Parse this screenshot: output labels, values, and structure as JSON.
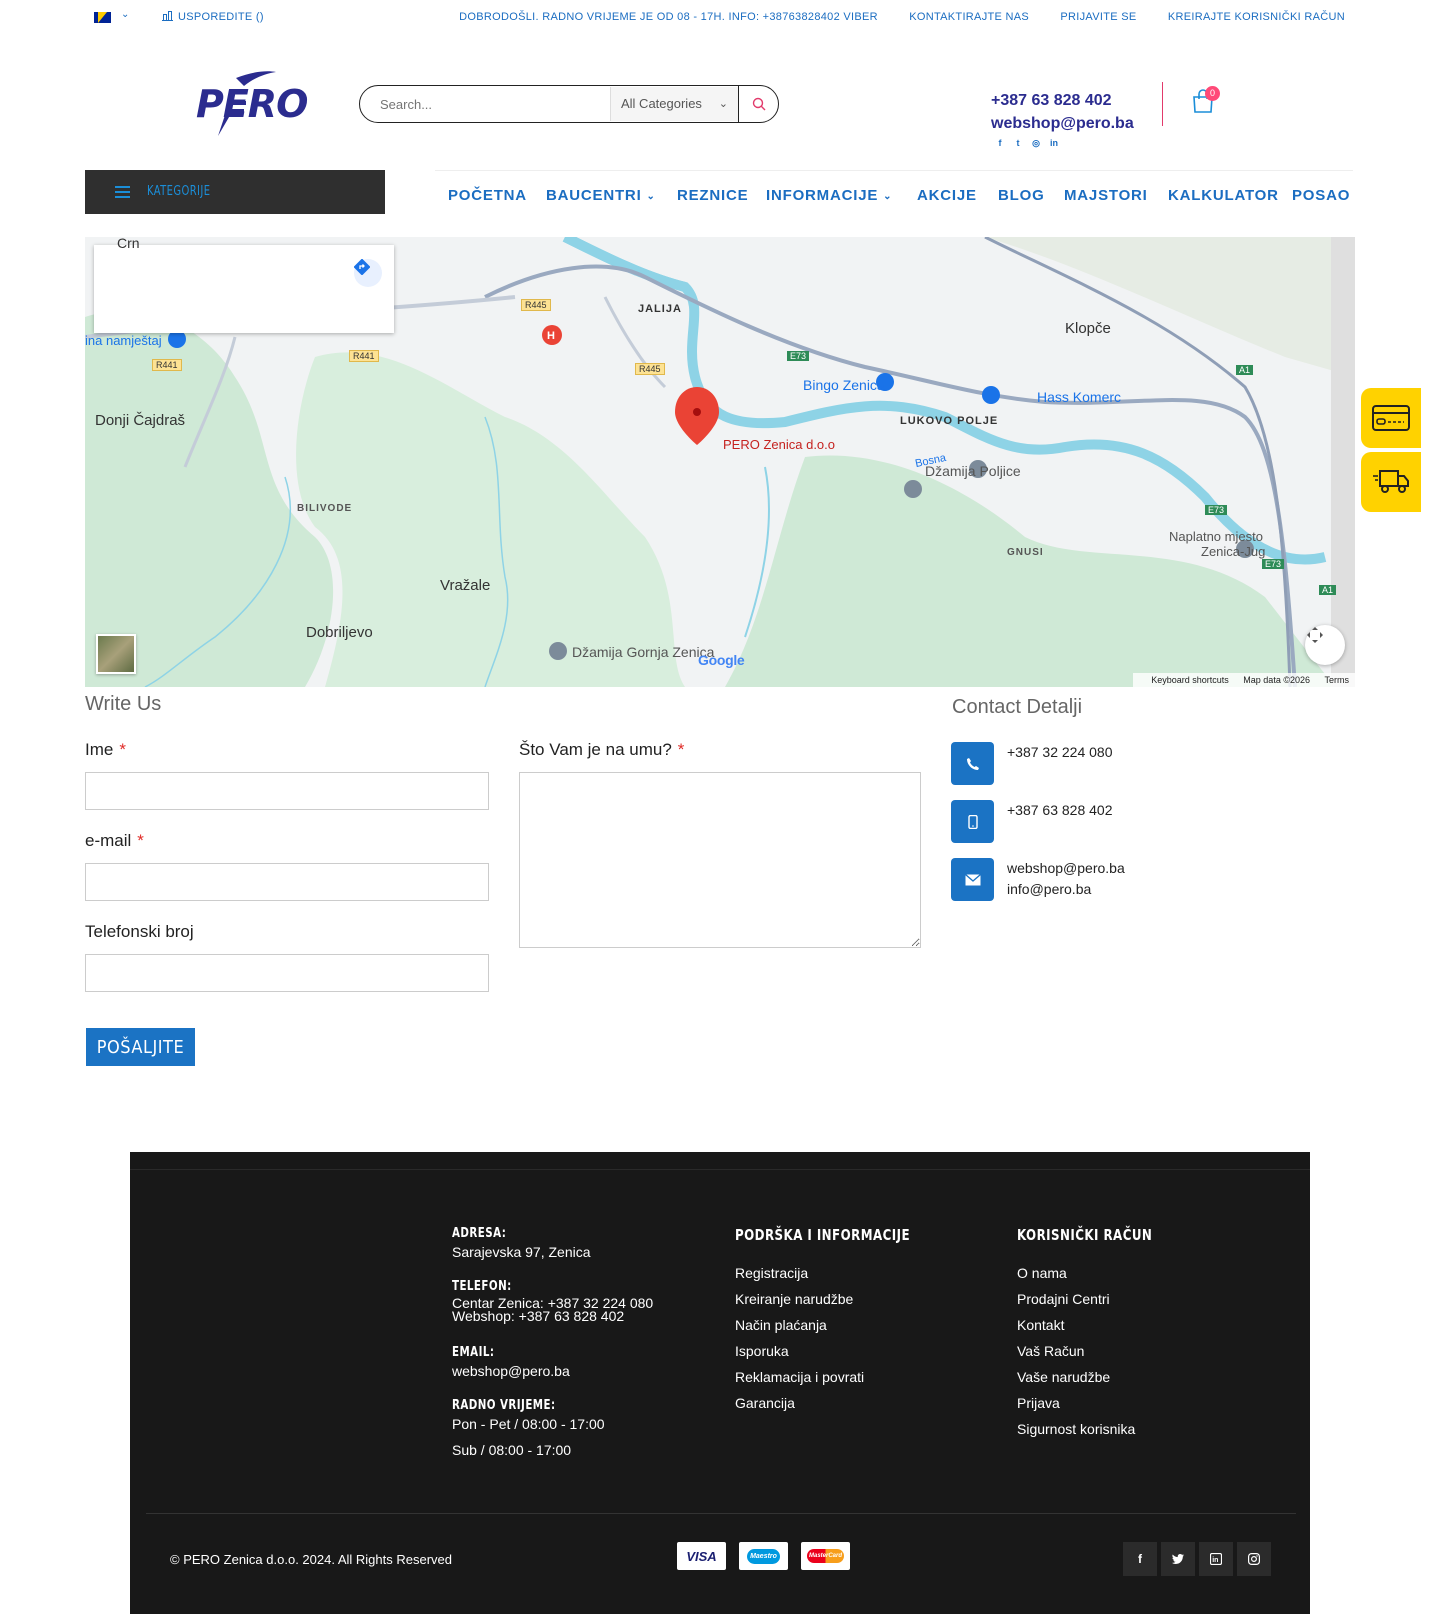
{
  "topbar": {
    "compare_label": "USPOREDITE ()",
    "welcome": "DOBRODOŠLI. RADNO VRIJEME JE OD 08 - 17H. INFO: +38763828402 VIBER",
    "contact": "KONTAKTIRAJTE NAS",
    "login": "PRIJAVITE SE",
    "register": "KREIRAJTE KORISNIČKI RAČUN"
  },
  "header": {
    "logo_text": "PERO",
    "search_placeholder": "Search...",
    "category_select": "All Categories",
    "phone": "+387 63 828 402",
    "email": "webshop@pero.ba",
    "cart_count": "0",
    "social": [
      "facebook-icon",
      "twitter-icon",
      "instagram-icon",
      "linkedin-icon"
    ]
  },
  "nav": {
    "categories_label": "KATEGORIJE",
    "items": [
      {
        "label": "POČETNA"
      },
      {
        "label": "BAUCENTRI"
      },
      {
        "label": "REZNICE"
      },
      {
        "label": "INFORMACIJE"
      },
      {
        "label": "AKCIJE"
      },
      {
        "label": "BLOG"
      },
      {
        "label": "MAJSTORI"
      },
      {
        "label": "KALKULATOR"
      },
      {
        "label": "POSAO"
      }
    ]
  },
  "map": {
    "places": {
      "crn": "Crn",
      "jalija": "JALIJA",
      "klopce": "Klopče",
      "namjestaj": "ina namještaj",
      "donji": "Donji Čajdraš",
      "bingo": "Bingo Zenica",
      "hass": "Hass Komerc",
      "lukovo": "LUKOVO POLJE",
      "pero": "PERO Zenica d.o.o",
      "bosna": "Bosna",
      "dzamija_poljice": "Džamija Poljice",
      "bilivode": "BILIVODE",
      "gnusi": "GNUSI",
      "naplatno": "Naplatno mjesto",
      "zenica_jug": "Zenica-Jug",
      "vrazale": "Vražale",
      "dobriljevo": "Dobriljevo",
      "dzamija_gornja": "Džamija Gornja Zenica"
    },
    "roads": {
      "r445": "R445",
      "r441": "R441",
      "e73": "E73",
      "a1": "A1"
    },
    "google": "Google",
    "footer": {
      "shortcuts": "Keyboard shortcuts",
      "data": "Map data ©2026",
      "terms": "Terms"
    }
  },
  "form": {
    "title": "Write Us",
    "name_label": "Ime",
    "email_label": "e-mail",
    "phone_label": "Telefonski broj",
    "message_label": "Što Vam je na umu?",
    "required_mark": "*",
    "submit": "POŠALJITE"
  },
  "contact_details": {
    "title": "Contact Detalji",
    "phone": "+387 32 224 080",
    "mobile": "+387 63 828 402",
    "email1": "webshop@pero.ba",
    "email2": "info@pero.ba"
  },
  "footer": {
    "address_h": "ADRESA:",
    "address": "Sarajevska 97, Zenica",
    "phone_h": "TELEFON:",
    "phone1": "Centar Zenica: +387 32 224 080",
    "phone2": "Webshop: +387 63 828 402",
    "email_h": "EMAIL:",
    "email": "webshop@pero.ba",
    "hours_h": "RADNO VRIJEME:",
    "hours1": "Pon - Pet / 08:00 - 17:00",
    "hours2": "Sub / 08:00 - 17:00",
    "support_h": "PODRŠKA I INFORMACIJE",
    "support": [
      "Registracija",
      "Kreiranje narudžbe",
      "Način plaćanja",
      "Isporuka",
      "Reklamacija i povrati",
      "Garancija"
    ],
    "account_h": "KORISNIČKI RAČUN",
    "account": [
      "O nama",
      "Prodajni Centri",
      "Kontakt",
      "Vaš Račun",
      "Vaše narudžbe",
      "Prijava",
      "Sigurnost korisnika"
    ],
    "copyright": "© PERO Zenica d.o.o. 2024. All Rights Reserved",
    "payments": {
      "visa": "VISA",
      "maestro": "Maestro",
      "mastercard": "MasterCard"
    },
    "social": [
      "facebook-icon",
      "twitter-icon",
      "linkedin-icon",
      "instagram-icon"
    ]
  },
  "colors": {
    "brand_blue": "#1b6dc1",
    "logo_navy": "#2b2c8f",
    "side_yellow": "#ffd200",
    "footer_bg": "#181818"
  }
}
